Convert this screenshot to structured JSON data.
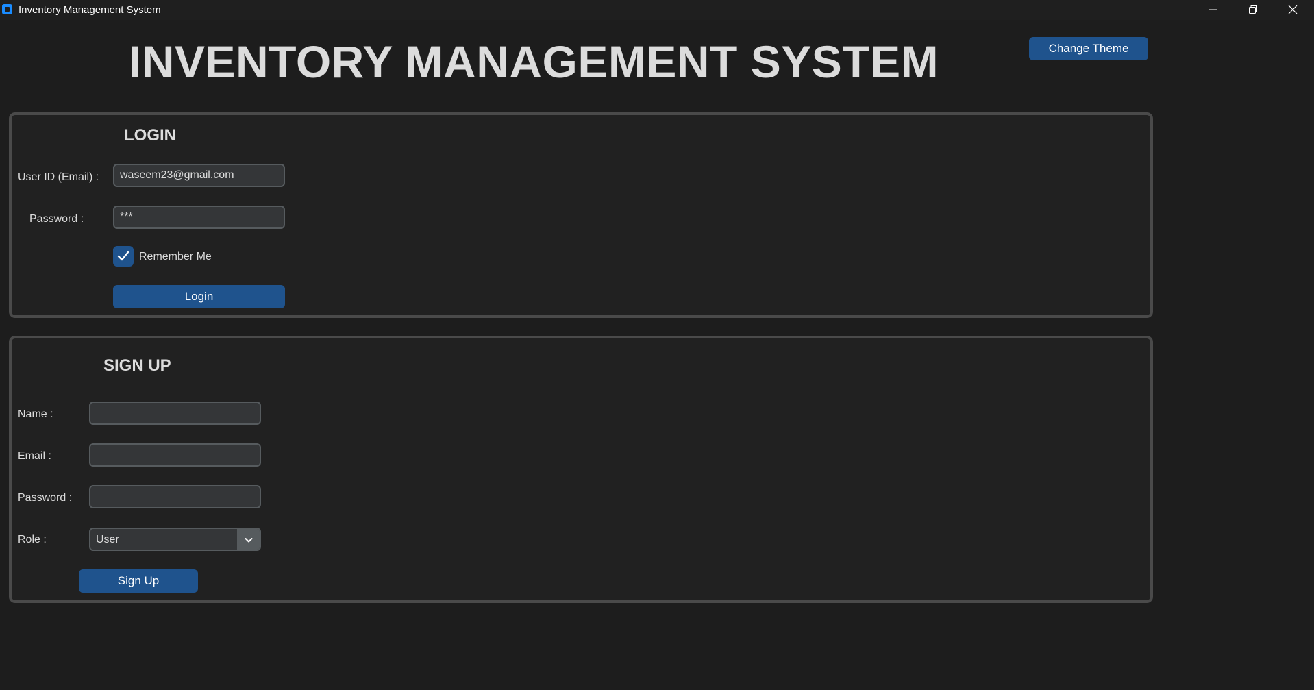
{
  "window": {
    "title": "Inventory Management System",
    "icon": "app-icon"
  },
  "header": {
    "title": "INVENTORY MANAGEMENT SYSTEM",
    "theme_button": "Change Theme"
  },
  "login": {
    "title": "LOGIN",
    "user_label": "User ID (Email) :",
    "user_value": "waseem23@gmail.com",
    "password_label": "Password :",
    "password_value": "***",
    "remember_label": "Remember Me",
    "remember_checked": true,
    "button": "Login"
  },
  "signup": {
    "title": "SIGN UP",
    "name_label": "Name :",
    "name_value": "",
    "email_label": "Email :",
    "email_value": "",
    "password_label": "Password :",
    "password_value": "",
    "role_label": "Role :",
    "role_value": "User",
    "button": "Sign Up"
  },
  "colors": {
    "background": "#1d1d1d",
    "panel": "#212121",
    "accent": "#1f538d",
    "border": "#4a4a4a"
  }
}
